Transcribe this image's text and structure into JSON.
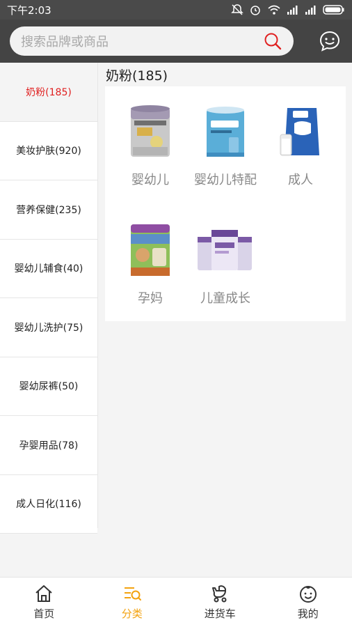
{
  "status": {
    "time": "下午2:03",
    "icons": [
      "mute-icon",
      "alarm-icon",
      "wifi-icon",
      "signal-icon",
      "signal-icon",
      "battery-icon"
    ]
  },
  "search": {
    "placeholder": "搜索品牌或商品"
  },
  "sidebar": {
    "items": [
      {
        "label": "奶粉(185)",
        "active": true
      },
      {
        "label": "美妆护肤(920)",
        "active": false
      },
      {
        "label": "营养保健(235)",
        "active": false
      },
      {
        "label": "婴幼儿辅食(40)",
        "active": false
      },
      {
        "label": "婴幼儿洗护(75)",
        "active": false
      },
      {
        "label": "婴幼尿裤(50)",
        "active": false
      },
      {
        "label": "孕婴用品(78)",
        "active": false
      },
      {
        "label": "成人日化(116)",
        "active": false
      }
    ]
  },
  "content": {
    "title": "奶粉(185)",
    "categories": [
      {
        "label": "婴幼儿"
      },
      {
        "label": "婴幼儿特配"
      },
      {
        "label": "成人"
      },
      {
        "label": "孕妈"
      },
      {
        "label": "儿童成长"
      }
    ]
  },
  "nav": {
    "items": [
      {
        "label": "首页",
        "icon": "home-icon",
        "active": false
      },
      {
        "label": "分类",
        "icon": "category-icon",
        "active": true
      },
      {
        "label": "进货车",
        "icon": "stroller-cart-icon",
        "active": false
      },
      {
        "label": "我的",
        "icon": "baby-face-icon",
        "active": false
      }
    ]
  },
  "colors": {
    "accent_red": "#e02020",
    "nav_active": "#f3a20f",
    "header_bg": "#444444"
  }
}
